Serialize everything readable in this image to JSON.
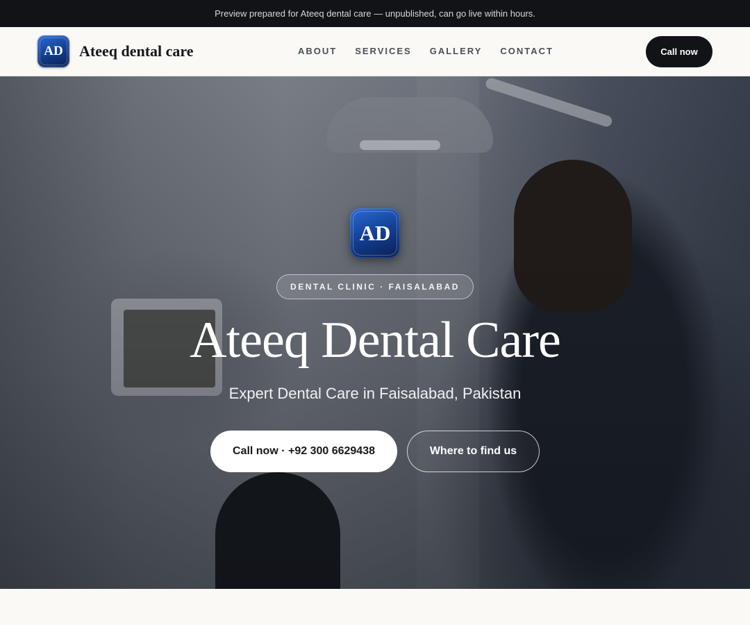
{
  "preview_bar": {
    "text": "Preview prepared for Ateeq dental care — unpublished, can go live within hours."
  },
  "header": {
    "logo_text": "AD",
    "brand_name": "Ateeq dental care",
    "nav": [
      {
        "label": "ABOUT"
      },
      {
        "label": "SERVICES"
      },
      {
        "label": "GALLERY"
      },
      {
        "label": "CONTACT"
      }
    ],
    "call_button": "Call now"
  },
  "hero": {
    "logo_text": "AD",
    "tag": "DENTAL CLINIC · FAISALABAD",
    "title": "Ateeq Dental Care",
    "subtitle": "Expert Dental Care in Faisalabad, Pakistan",
    "primary_button": "Call now · +92 300 6629438",
    "secondary_button": "Where to find us",
    "background_image": "dentist-treating-patient"
  },
  "colors": {
    "brand_blue": "#1a4fb0",
    "dark": "#111317",
    "page_bg": "#faf9f6"
  }
}
